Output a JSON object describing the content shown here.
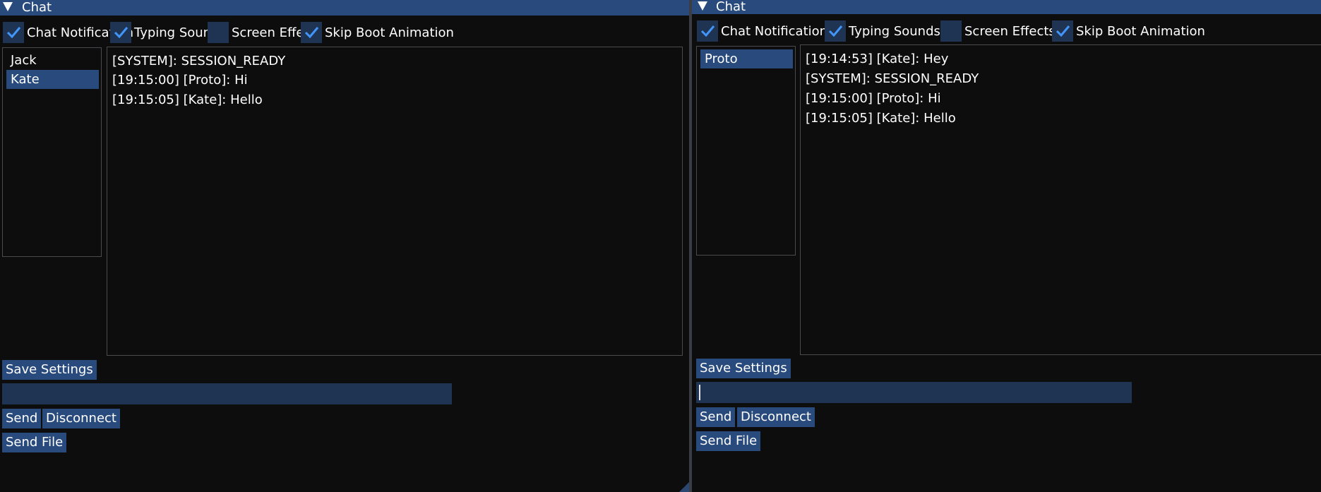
{
  "colors": {
    "title_bar": "#284a7c",
    "frame_bg": "#1f3352",
    "window_bg": "#0d0d0e",
    "check": "#4296fa"
  },
  "left": {
    "title": "Chat",
    "options": [
      {
        "label": "Chat Notification",
        "checked": true
      },
      {
        "label": "Typing Sounds",
        "checked": true
      },
      {
        "label": "Screen Effects",
        "checked": false
      },
      {
        "label": "Skip Boot Animation",
        "checked": true
      }
    ],
    "users": [
      {
        "name": "Jack",
        "selected": false
      },
      {
        "name": "Kate",
        "selected": true
      }
    ],
    "messages": [
      "[SYSTEM]: SESSION_READY",
      "[19:15:00] [Proto]: Hi",
      "[19:15:05] [Kate]: Hello"
    ],
    "save_label": "Save Settings",
    "message_input": "",
    "send_label": "Send",
    "disconnect_label": "Disconnect",
    "send_file_label": "Send File"
  },
  "right": {
    "title": "Chat",
    "options": [
      {
        "label": "Chat Notification",
        "checked": true
      },
      {
        "label": "Typing Sounds",
        "checked": true
      },
      {
        "label": "Screen Effects",
        "checked": false
      },
      {
        "label": "Skip Boot Animation",
        "checked": true
      }
    ],
    "users": [
      {
        "name": "Proto",
        "selected": true
      }
    ],
    "messages": [
      "[19:14:53] [Kate]: Hey",
      "[SYSTEM]: SESSION_READY",
      "[19:15:00] [Proto]: Hi",
      "[19:15:05] [Kate]: Hello"
    ],
    "save_label": "Save Settings",
    "message_input": "",
    "send_label": "Send",
    "disconnect_label": "Disconnect",
    "send_file_label": "Send File"
  }
}
